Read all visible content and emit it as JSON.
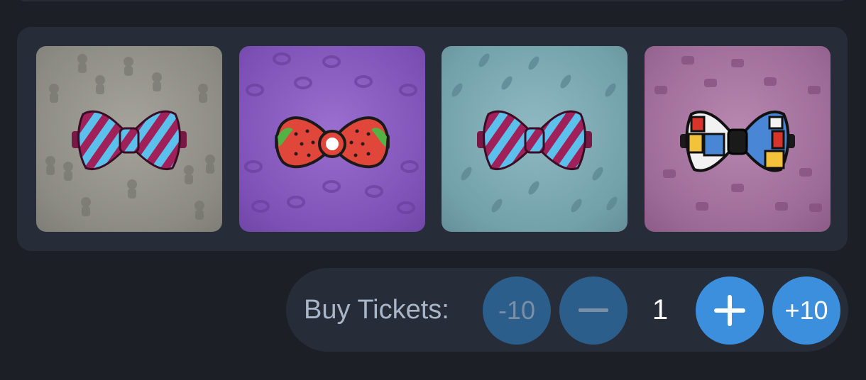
{
  "gallery": {
    "items": [
      {
        "icon": "striped-bow-tie-icon",
        "background": "gingerbread-pattern",
        "color": "#8c8b83"
      },
      {
        "icon": "strawberry-bow-tie-icon",
        "background": "bowl-pattern",
        "color": "#7e51b6"
      },
      {
        "icon": "striped-bow-tie-icon",
        "background": "leaf-pattern",
        "color": "#72a1aa"
      },
      {
        "icon": "mondrian-bow-tie-icon",
        "background": "teacup-pattern",
        "color": "#9c6a96"
      }
    ]
  },
  "tickets": {
    "label": "Buy Tickets:",
    "minus10_label": "-10",
    "minus_icon": "minus-icon",
    "quantity": "1",
    "plus_icon": "plus-icon",
    "plus10_label": "+10"
  },
  "colors": {
    "background": "#1c2026",
    "panel": "#262d38",
    "button_disabled": "#2c5e8c",
    "button_active": "#3b8fdd"
  }
}
